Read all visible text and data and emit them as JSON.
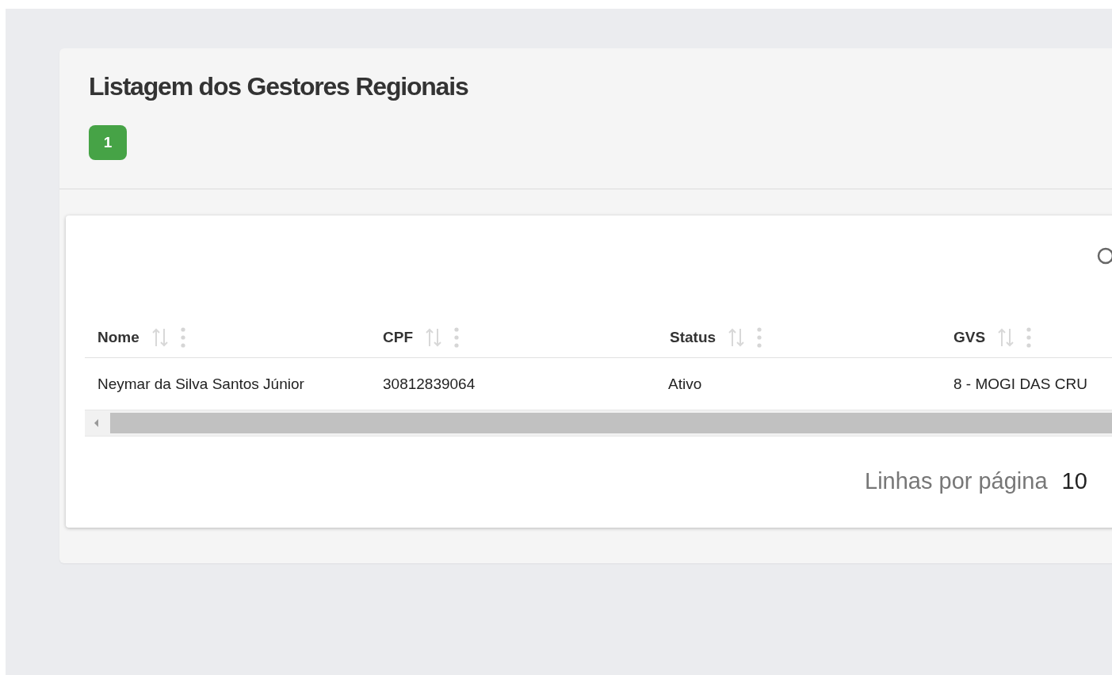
{
  "panel": {
    "title": "Listagem dos Gestores Regionais",
    "count_badge": "1"
  },
  "table": {
    "columns": [
      {
        "label": "Nome"
      },
      {
        "label": "CPF"
      },
      {
        "label": "Status"
      },
      {
        "label": "GVS"
      }
    ],
    "rows": [
      {
        "cells": [
          "Neymar da Silva Santos Júnior",
          "30812839064",
          "Ativo",
          "8 - MOGI DAS CRU"
        ]
      }
    ]
  },
  "pagination": {
    "rows_per_page_label": "Linhas por página",
    "rows_per_page": "10"
  }
}
